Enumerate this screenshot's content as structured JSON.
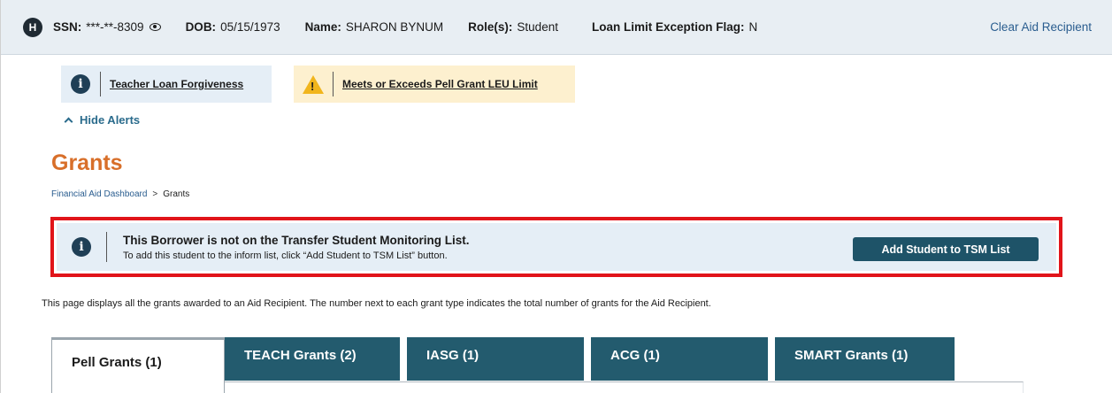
{
  "header": {
    "badge": "H",
    "ssn_label": "SSN:",
    "ssn_value": "***-**-8309",
    "dob_label": "DOB:",
    "dob_value": "05/15/1973",
    "name_label": "Name:",
    "name_value": "SHARON BYNUM",
    "roles_label": "Role(s):",
    "roles_value": "Student",
    "flag_label": "Loan Limit Exception Flag:",
    "flag_value": "N",
    "clear_link": "Clear Aid Recipient"
  },
  "alerts": {
    "info_label": "Teacher Loan Forgiveness",
    "warning_label": "Meets or Exceeds Pell Grant LEU Limit",
    "hide_label": "Hide Alerts"
  },
  "page": {
    "title": "Grants",
    "breadcrumb": [
      "Financial Aid Dashboard",
      "Grants"
    ]
  },
  "tsm": {
    "heading": "This Borrower is not on the Transfer Student Monitoring List.",
    "subtext": "To add this student to the inform list, click “Add Student to TSM List” button.",
    "button_label": "Add Student to TSM List"
  },
  "description": "This page displays all the grants awarded to an Aid Recipient. The number next to each grant type indicates the total number of grants for the Aid Recipient.",
  "tabs": [
    {
      "label": "Pell Grants (1)",
      "active": true
    },
    {
      "label": "TEACH Grants (2)",
      "active": false
    },
    {
      "label": "IASG (1)",
      "active": false
    },
    {
      "label": "ACG (1)",
      "active": false
    },
    {
      "label": "SMART Grants (1)",
      "active": false
    }
  ],
  "colors": {
    "accent_title": "#d86f2a",
    "highlight_border": "#e1141a",
    "tab_dark": "#235b6e",
    "button": "#1e5368",
    "info_bg": "#e5eef6",
    "warn_bg": "#fdf0cf"
  }
}
